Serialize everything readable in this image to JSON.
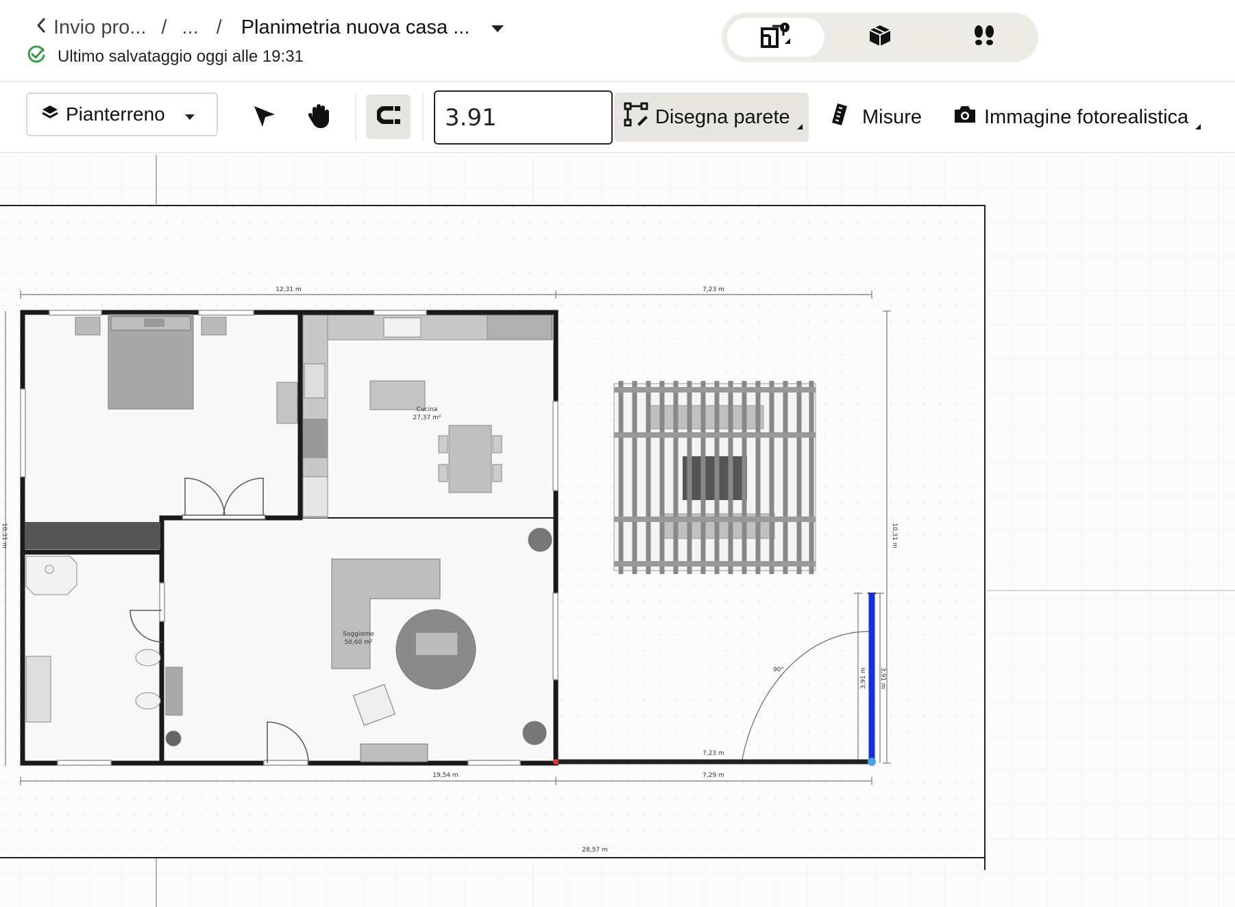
{
  "header": {
    "back_label": "Invio pro...",
    "ellipsis": "...",
    "separator": "/",
    "project_title": "Planimetria nuova casa ...",
    "save_status": "Ultimo salvataggio oggi alle 19:31",
    "view_modes": [
      "2d-plan-icon",
      "3d-box-icon",
      "footsteps-icon"
    ],
    "active_view": "2d-plan-icon"
  },
  "toolbar": {
    "floor_label": "Pianterreno",
    "length_value": "3.91",
    "draw_wall_label": "Disegna parete",
    "measures_label": "Misure",
    "photo_label": "Immagine fotorealistica"
  },
  "plan": {
    "dim_top_left": "12,31 m",
    "dim_top_right": "7,23 m",
    "dim_bottom_main": "19,54 m",
    "dim_bottom_right": "7,29 m",
    "dim_wall_inner": "7,23 m",
    "dim_overall": "28,57 m",
    "dim_right_side": "10,31 m",
    "dim_left_side": "10,31 m",
    "dim_new_wall_a": "3,91 m",
    "dim_new_wall_b": "3,91 m",
    "angle": "90°",
    "room_kitchen_name": "Cucina",
    "room_kitchen_area": "27,37 m²",
    "room_living_name": "Soggiorno",
    "room_living_area": "50,60 m²"
  },
  "colors": {
    "accent": "#2f9e44",
    "wall": "#1a1a1a",
    "new_wall": "#1530d6",
    "toolbar_active": "#e6e5df",
    "furniture": "#b8b8b8"
  }
}
